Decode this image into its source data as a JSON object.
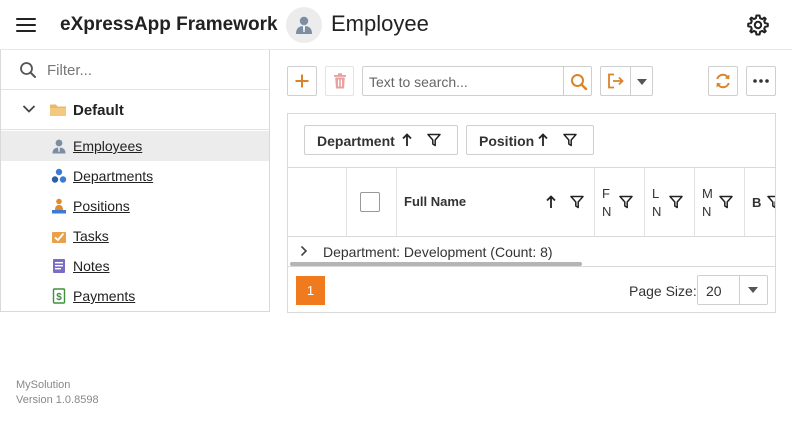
{
  "header": {
    "app_title": "eXpressApp Framework",
    "view_title": "Employee"
  },
  "sidebar": {
    "filter_placeholder": "Filter...",
    "group_label": "Default",
    "items": [
      {
        "label": "Employees",
        "icon": "employee-icon",
        "selected": true
      },
      {
        "label": "Departments",
        "icon": "departments-icon",
        "selected": false
      },
      {
        "label": "Positions",
        "icon": "positions-icon",
        "selected": false
      },
      {
        "label": "Tasks",
        "icon": "tasks-icon",
        "selected": false
      },
      {
        "label": "Notes",
        "icon": "notes-icon",
        "selected": false
      },
      {
        "label": "Payments",
        "icon": "payments-icon",
        "selected": false
      }
    ],
    "footer_solution": "MySolution",
    "footer_version": "Version 1.0.8598"
  },
  "toolbar": {
    "search_placeholder": "Text to search..."
  },
  "grid": {
    "group_chips": [
      "Department",
      "Position"
    ],
    "columns": {
      "full_name": "Full Name",
      "col_f_1": "F",
      "col_f_2": "N",
      "col_l_1": "L",
      "col_l_2": "N",
      "col_m_1": "M",
      "col_m_2": "N",
      "col_b": "B"
    },
    "group_row_text": "Department: Development (Count: 8)",
    "pager": {
      "current_page": "1",
      "page_size_label": "Page Size:",
      "page_size_value": "20"
    }
  },
  "colors": {
    "accent": "#f07b1f",
    "toolbar_icon": "#d9842a",
    "delete_disabled": "#e8a0a0"
  }
}
